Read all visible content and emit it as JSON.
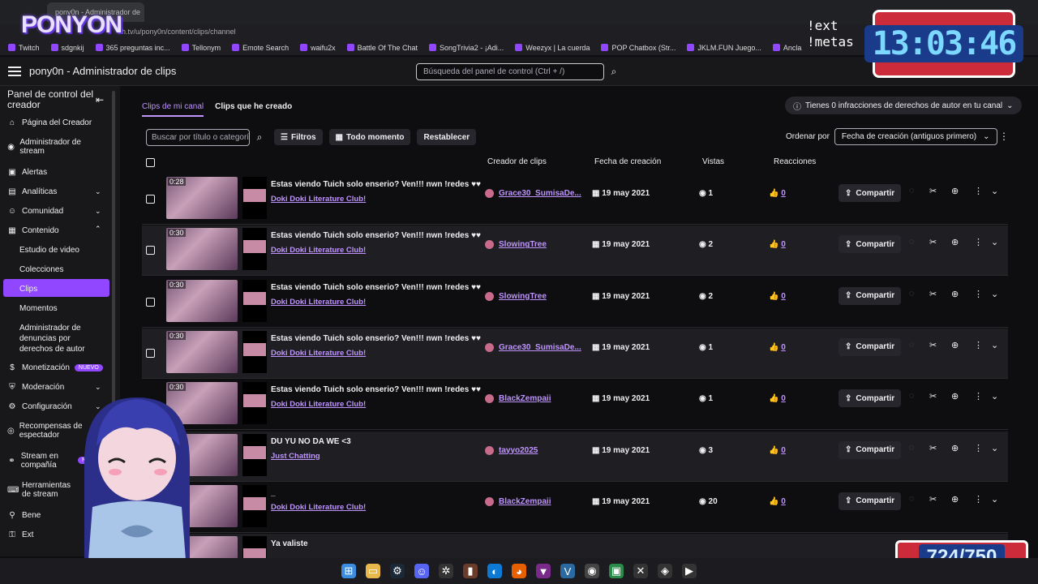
{
  "browser": {
    "tab_title": "pony0n - Administrador de",
    "url": "h.tv/u/pony0n/content/clips/channel",
    "bookmarks": [
      "Twitch",
      "sdgnkij",
      "365 preguntas inc...",
      "Tellonym",
      "Emote Search",
      "waifu2x",
      "Battle Of The Chat",
      "SongTrivia2 - ¡Adi...",
      "Weezyx | La cuerda",
      "POP Chatbox (Str...",
      "JKLM.FUN Juego...",
      "Ancla"
    ]
  },
  "overlay": {
    "logo": "PONYON",
    "clock": "13:03:46",
    "commands": [
      "!ext",
      "!metas"
    ],
    "counter": "724/750"
  },
  "header": {
    "title": "pony0n - Administrador de clips",
    "search_placeholder": "Búsqueda del panel de control (Ctrl + /)"
  },
  "sidebar": {
    "title": "Panel de control del creador",
    "items": [
      {
        "label": "Página del Creador",
        "icon": "home-icon"
      },
      {
        "label": "Administrador de stream",
        "icon": "stream-icon"
      },
      {
        "label": "Alertas",
        "icon": "alert-icon"
      },
      {
        "label": "Analíticas",
        "icon": "analytics-icon"
      },
      {
        "label": "Comunidad",
        "icon": "community-icon"
      },
      {
        "label": "Contenido",
        "icon": "content-icon"
      }
    ],
    "content_sub": [
      "Estudio de video",
      "Colecciones",
      "Clips",
      "Momentos",
      "Administrador de denuncias por derechos de autor"
    ],
    "items2": [
      {
        "label": "Monetización",
        "icon": "money-icon",
        "badge": "NUEVO"
      },
      {
        "label": "Moderación",
        "icon": "shield-icon"
      },
      {
        "label": "Configuración",
        "icon": "gear-icon"
      },
      {
        "label": "Recompensas de espectador",
        "icon": "reward-icon"
      },
      {
        "label": "Stream en compañía",
        "icon": "together-icon",
        "badge": "NUEV"
      },
      {
        "label": "Herramientas de stream",
        "icon": "tools-icon"
      },
      {
        "label": "Bene",
        "icon": "benefits-icon"
      },
      {
        "label": "Ext",
        "icon": "extensions-icon"
      }
    ]
  },
  "tabs": [
    "Clips de mi canal",
    "Clips que he creado"
  ],
  "copyright_notice": "Tienes 0 infracciones de derechos de autor en tu canal",
  "toolbar": {
    "search_placeholder": "Buscar por título o categoría",
    "filters": "Filtros",
    "time": "Todo momento",
    "reset": "Restablecer",
    "sort_label": "Ordenar por",
    "sort_value": "Fecha de creación (antiguos primero)"
  },
  "columns": [
    "Creador de clips",
    "Fecha de creación",
    "Vistas",
    "Reacciones"
  ],
  "share_label": "Compartir",
  "clips": [
    {
      "duration": "0:28",
      "title": "Estas viendo Tuich solo enserio? Ven!!! nwn !redes ♥♥",
      "game": "Doki Doki Literature Club!",
      "creator": "Grace30_SumisaDe...",
      "date": "19 may 2021",
      "views": "1",
      "likes": "0"
    },
    {
      "duration": "0:30",
      "title": "Estas viendo Tuich solo enserio? Ven!!! nwn !redes ♥♥",
      "game": "Doki Doki Literature Club!",
      "creator": "SlowingTree",
      "date": "19 may 2021",
      "views": "2",
      "likes": "0"
    },
    {
      "duration": "0:30",
      "title": "Estas viendo Tuich solo enserio? Ven!!! nwn !redes ♥♥",
      "game": "Doki Doki Literature Club!",
      "creator": "SlowingTree",
      "date": "19 may 2021",
      "views": "2",
      "likes": "0"
    },
    {
      "duration": "0:30",
      "title": "Estas viendo Tuich solo enserio? Ven!!! nwn !redes ♥♥",
      "game": "Doki Doki Literature Club!",
      "creator": "Grace30_SumisaDe...",
      "date": "19 may 2021",
      "views": "1",
      "likes": "0"
    },
    {
      "duration": "0:30",
      "title": "Estas viendo Tuich solo enserio? Ven!!! nwn !redes ♥♥",
      "game": "Doki Doki Literature Club!",
      "creator": "BlackZempaii",
      "date": "19 may 2021",
      "views": "1",
      "likes": "0"
    },
    {
      "duration": "",
      "title": "DU YU NO DA WE <3",
      "game": "Just Chatting",
      "creator": "tayyo2025",
      "date": "19 may 2021",
      "views": "3",
      "likes": "0"
    },
    {
      "duration": "",
      "title": "_",
      "game": "Doki Doki Literature Club!",
      "creator": "BlackZempaii",
      "date": "19 may 2021",
      "views": "20",
      "likes": "0"
    },
    {
      "duration": "",
      "title": "Ya valiste",
      "game": "",
      "creator": "",
      "date": "",
      "views": "",
      "likes": ""
    }
  ],
  "colors": {
    "accent": "#9146ff",
    "link": "#bf94ff",
    "bg": "#0e0e10",
    "panel": "#18181b"
  }
}
